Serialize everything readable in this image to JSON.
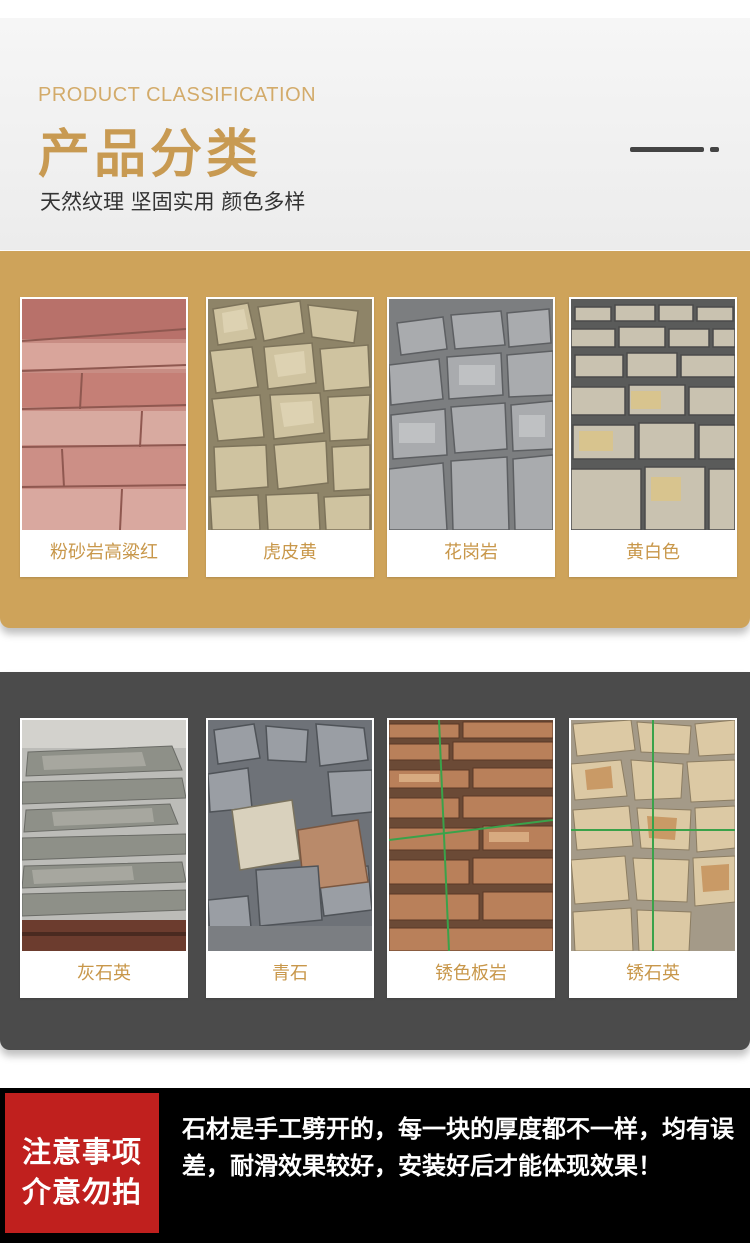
{
  "header": {
    "en_title": "PRODUCT CLASSIFICATION",
    "zh_title": "产品分类",
    "subtitle": "天然纹理 坚固实用 颜色多样"
  },
  "colors": {
    "accent_gold": "#cea35a",
    "title_gold": "#c89a52",
    "panel_dark": "#4b4b4b",
    "notice_red": "#c0201e"
  },
  "row1": [
    {
      "label": "粉砂岩高粱红"
    },
    {
      "label": "虎皮黄"
    },
    {
      "label": "花岗岩"
    },
    {
      "label": "黄白色"
    }
  ],
  "row2": [
    {
      "label": "灰石英"
    },
    {
      "label": "青石"
    },
    {
      "label": "锈色板岩"
    },
    {
      "label": "锈石英"
    }
  ],
  "notice": {
    "badge_line1": "注意事项",
    "badge_line2": "介意勿拍",
    "text": "石材是手工劈开的，每一块的厚度都不一样，均有误差，耐滑效果较好，安装好后才能体现效果！"
  }
}
